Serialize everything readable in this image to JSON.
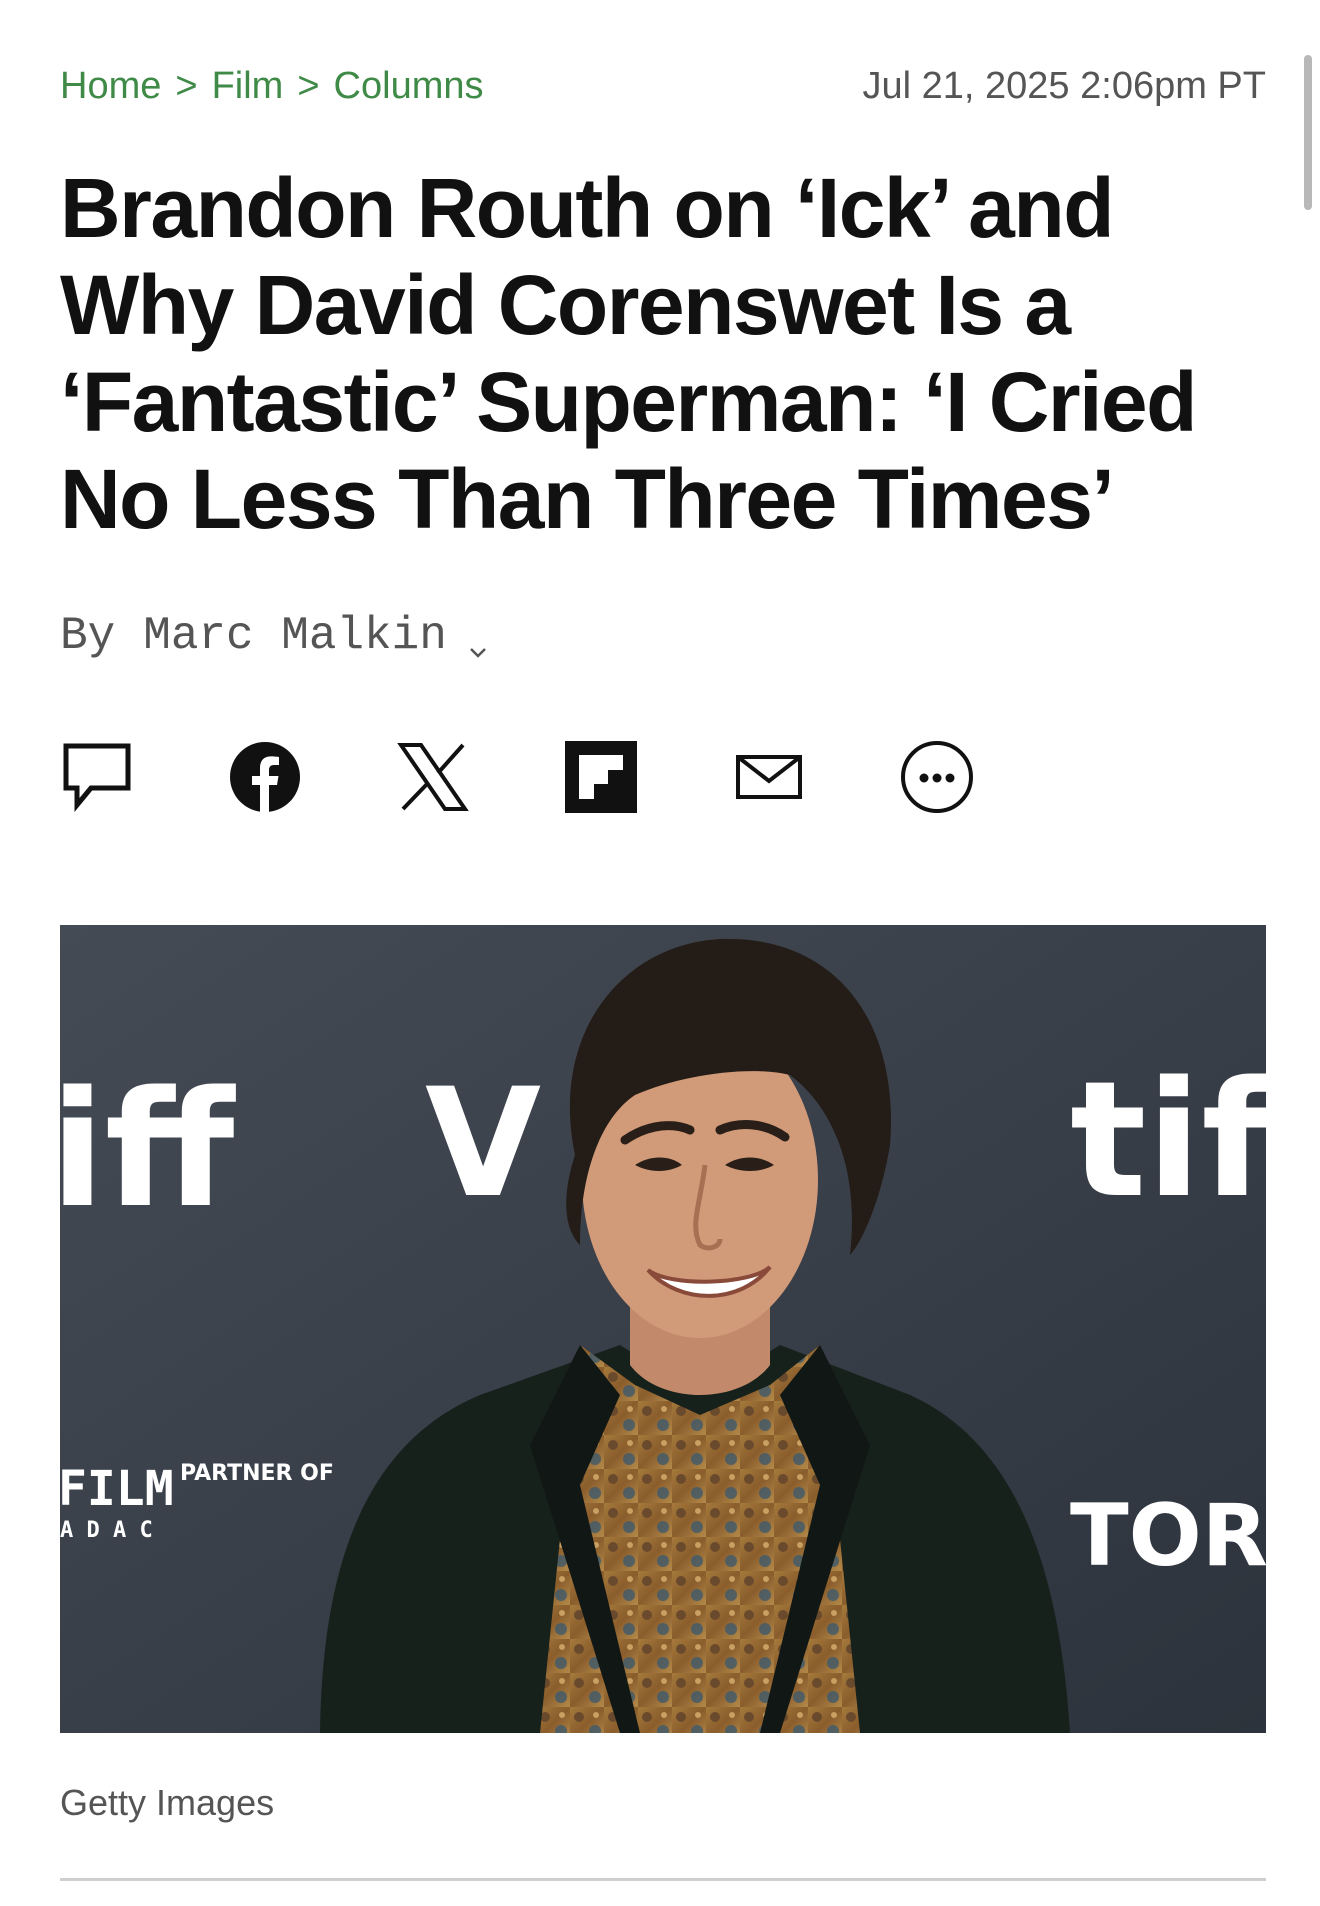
{
  "breadcrumb": [
    {
      "label": "Home"
    },
    {
      "label": "Film"
    },
    {
      "label": "Columns"
    }
  ],
  "breadcrumb_separator": ">",
  "dateline": "Jul 21, 2025 2:06pm PT",
  "headline": "Brandon Routh on ‘Ick’ and Why David Corenswet Is a ‘Fantastic’ Superman: ‘I Cried No Less Than Three Times’",
  "byline": {
    "prefix": "By",
    "author": "Marc Malkin"
  },
  "share_icons": [
    "comment-icon",
    "facebook-icon",
    "x-icon",
    "flipboard-icon",
    "email-icon",
    "more-icon"
  ],
  "photo": {
    "credit": "Getty Images",
    "backdrop_text": {
      "left_logo": "iff",
      "left_film": "FILM",
      "left_partner": "PARTNER OF",
      "left_sub": "A D A C",
      "center_letter": "V",
      "right_logo": "tiff",
      "right_city": "TORON"
    }
  },
  "colors": {
    "breadcrumb": "#3f8a47",
    "backdrop": "#3a4049"
  }
}
